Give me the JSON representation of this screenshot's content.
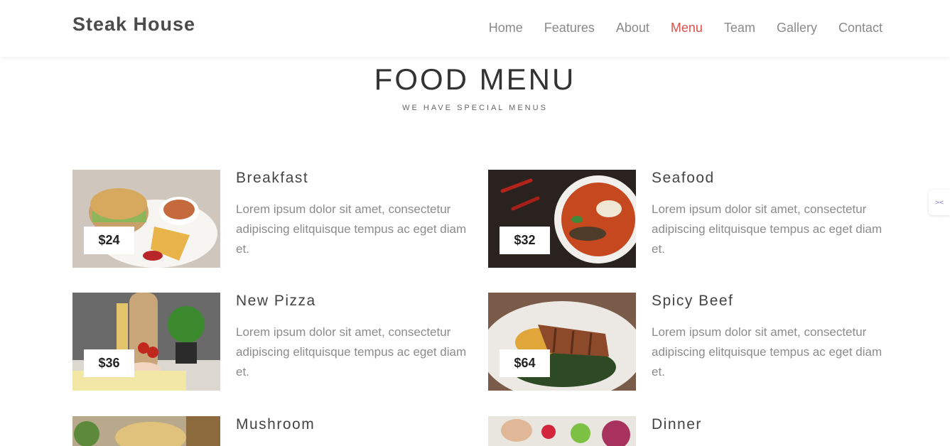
{
  "brand": "Steak House",
  "nav": {
    "items": [
      "Home",
      "Features",
      "About",
      "Menu",
      "Team",
      "Gallery",
      "Contact"
    ],
    "active": "Menu"
  },
  "section": {
    "title": "FOOD MENU",
    "subtitle": "WE HAVE SPECIAL MENUS"
  },
  "menu_items": [
    {
      "name": "Breakfast",
      "price": "$24",
      "description": "Lorem ipsum dolor sit amet, consectetur adipiscing elitquisque tempus ac eget diam et."
    },
    {
      "name": "Seafood",
      "price": "$32",
      "description": "Lorem ipsum dolor sit amet, consectetur adipiscing elitquisque tempus ac eget diam et."
    },
    {
      "name": "New Pizza",
      "price": "$36",
      "description": "Lorem ipsum dolor sit amet, consectetur adipiscing elitquisque tempus ac eget diam et."
    },
    {
      "name": "Spicy Beef",
      "price": "$64",
      "description": "Lorem ipsum dolor sit amet, consectetur adipiscing elitquisque tempus ac eget diam et."
    },
    {
      "name": "Mushroom",
      "price": "",
      "description": ""
    },
    {
      "name": "Dinner",
      "price": "",
      "description": ""
    }
  ],
  "colors": {
    "accent": "#d9534f",
    "brand_text": "#4b4b4b"
  },
  "icons": {
    "side_widget": "translate-widget-icon"
  }
}
